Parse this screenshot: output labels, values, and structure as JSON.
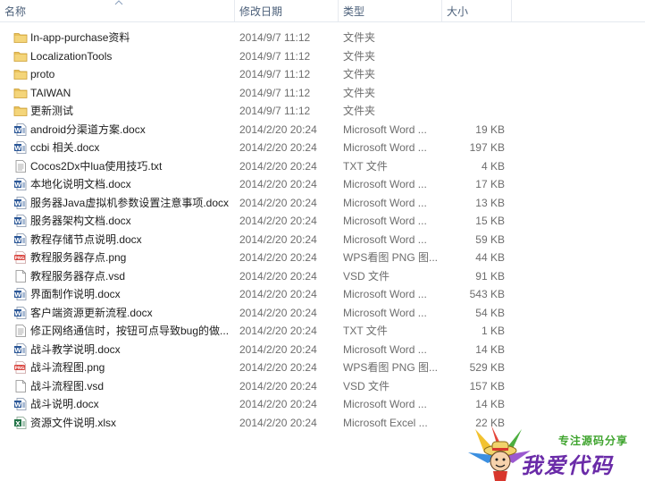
{
  "columns": {
    "name": "名称",
    "modified": "修改日期",
    "type": "类型",
    "size": "大小"
  },
  "files": [
    {
      "name": "In-app-purchase资料",
      "date": "2014/9/7 11:12",
      "type": "文件夹",
      "size": "",
      "icon": "folder-icon"
    },
    {
      "name": "LocalizationTools",
      "date": "2014/9/7 11:12",
      "type": "文件夹",
      "size": "",
      "icon": "folder-icon"
    },
    {
      "name": "proto",
      "date": "2014/9/7 11:12",
      "type": "文件夹",
      "size": "",
      "icon": "folder-icon"
    },
    {
      "name": "TAIWAN",
      "date": "2014/9/7 11:12",
      "type": "文件夹",
      "size": "",
      "icon": "folder-icon"
    },
    {
      "name": "更新测试",
      "date": "2014/9/7 11:12",
      "type": "文件夹",
      "size": "",
      "icon": "folder-icon"
    },
    {
      "name": "android分渠道方案.docx",
      "date": "2014/2/20 20:24",
      "type": "Microsoft Word ...",
      "size": "19 KB",
      "icon": "word-doc-icon"
    },
    {
      "name": "ccbi 相关.docx",
      "date": "2014/2/20 20:24",
      "type": "Microsoft Word ...",
      "size": "197 KB",
      "icon": "word-doc-icon"
    },
    {
      "name": "Cocos2Dx中lua使用技巧.txt",
      "date": "2014/2/20 20:24",
      "type": "TXT 文件",
      "size": "4 KB",
      "icon": "text-file-icon"
    },
    {
      "name": "本地化说明文档.docx",
      "date": "2014/2/20 20:24",
      "type": "Microsoft Word ...",
      "size": "17 KB",
      "icon": "word-doc-icon"
    },
    {
      "name": "服务器Java虚拟机参数设置注意事项.docx",
      "date": "2014/2/20 20:24",
      "type": "Microsoft Word ...",
      "size": "13 KB",
      "icon": "word-doc-icon"
    },
    {
      "name": "服务器架构文档.docx",
      "date": "2014/2/20 20:24",
      "type": "Microsoft Word ...",
      "size": "15 KB",
      "icon": "word-doc-icon"
    },
    {
      "name": "教程存储节点说明.docx",
      "date": "2014/2/20 20:24",
      "type": "Microsoft Word ...",
      "size": "59 KB",
      "icon": "word-doc-icon"
    },
    {
      "name": "教程服务器存点.png",
      "date": "2014/2/20 20:24",
      "type": "WPS看图 PNG 图...",
      "size": "44 KB",
      "icon": "png-image-icon"
    },
    {
      "name": "教程服务器存点.vsd",
      "date": "2014/2/20 20:24",
      "type": "VSD 文件",
      "size": "91 KB",
      "icon": "blank-file-icon"
    },
    {
      "name": "界面制作说明.docx",
      "date": "2014/2/20 20:24",
      "type": "Microsoft Word ...",
      "size": "543 KB",
      "icon": "word-doc-icon"
    },
    {
      "name": "客户端资源更新流程.docx",
      "date": "2014/2/20 20:24",
      "type": "Microsoft Word ...",
      "size": "54 KB",
      "icon": "word-doc-icon"
    },
    {
      "name": "修正网络通信时，按钮可点导致bug的做...",
      "date": "2014/2/20 20:24",
      "type": "TXT 文件",
      "size": "1 KB",
      "icon": "text-file-icon"
    },
    {
      "name": "战斗教学说明.docx",
      "date": "2014/2/20 20:24",
      "type": "Microsoft Word ...",
      "size": "14 KB",
      "icon": "word-doc-icon"
    },
    {
      "name": "战斗流程图.png",
      "date": "2014/2/20 20:24",
      "type": "WPS看图 PNG 图...",
      "size": "529 KB",
      "icon": "png-image-icon"
    },
    {
      "name": "战斗流程图.vsd",
      "date": "2014/2/20 20:24",
      "type": "VSD 文件",
      "size": "157 KB",
      "icon": "blank-file-icon"
    },
    {
      "name": "战斗说明.docx",
      "date": "2014/2/20 20:24",
      "type": "Microsoft Word ...",
      "size": "14 KB",
      "icon": "word-doc-icon"
    },
    {
      "name": "资源文件说明.xlsx",
      "date": "2014/2/20 20:24",
      "type": "Microsoft Excel ...",
      "size": "22 KB",
      "icon": "excel-sheet-icon"
    }
  ],
  "watermark": {
    "tagline": "专注源码分享",
    "brand": "我爱代码"
  },
  "colors": {
    "header_text": "#4c607a",
    "meta_text": "#6d6d6d",
    "folder_yellow": "#e9c25c",
    "word_blue": "#2b5797",
    "excel_green": "#207245",
    "png_red": "#d9413b"
  }
}
